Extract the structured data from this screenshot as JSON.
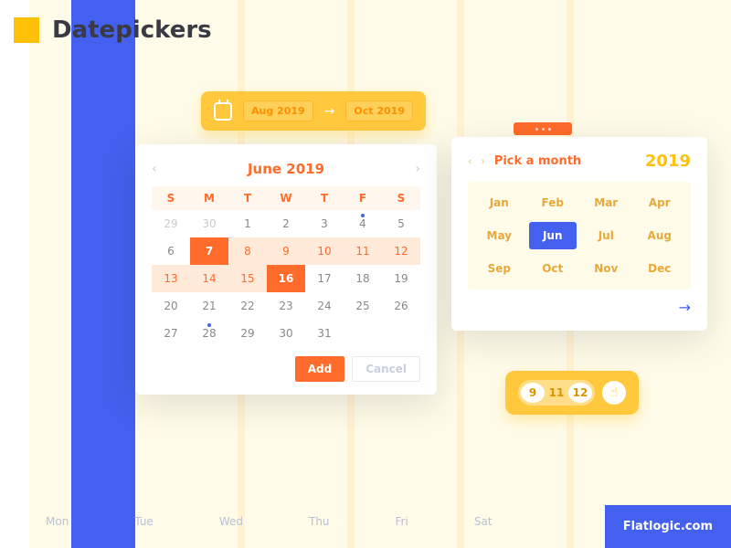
{
  "title": "Datepickers",
  "range": {
    "from": "Aug 2019",
    "to": "Oct 2019"
  },
  "calendar": {
    "title": "June 2019",
    "dow": [
      "S",
      "M",
      "T",
      "W",
      "T",
      "F",
      "S"
    ],
    "weeks": [
      [
        {
          "n": "29",
          "o": 1
        },
        {
          "n": "30",
          "o": 1
        },
        {
          "n": "1"
        },
        {
          "n": "2"
        },
        {
          "n": "3"
        },
        {
          "n": "4",
          "d": 1
        },
        {
          "n": "5"
        }
      ],
      [
        {
          "n": "6"
        },
        {
          "n": "7",
          "s": 1
        },
        {
          "n": "8",
          "r": 1
        },
        {
          "n": "9",
          "r": 1
        },
        {
          "n": "10",
          "r": 1
        },
        {
          "n": "11",
          "r": 1
        },
        {
          "n": "12",
          "r": 1
        }
      ],
      [
        {
          "n": "13",
          "r": 1
        },
        {
          "n": "14",
          "r": 1
        },
        {
          "n": "15",
          "r": 1
        },
        {
          "n": "16",
          "s": 1
        },
        {
          "n": "17"
        },
        {
          "n": "18"
        },
        {
          "n": "19"
        }
      ],
      [
        {
          "n": "20"
        },
        {
          "n": "21"
        },
        {
          "n": "22"
        },
        {
          "n": "23"
        },
        {
          "n": "24"
        },
        {
          "n": "25"
        },
        {
          "n": "26"
        }
      ],
      [
        {
          "n": "27"
        },
        {
          "n": "28",
          "d": 1
        },
        {
          "n": "29"
        },
        {
          "n": "30"
        },
        {
          "n": "31"
        },
        {
          "n": ""
        },
        {
          "n": ""
        }
      ]
    ],
    "add": "Add",
    "cancel": "Cancel"
  },
  "monthPicker": {
    "label": "Pick a month",
    "year": "2019",
    "months": [
      "Jan",
      "Feb",
      "Mar",
      "Apr",
      "May",
      "Jun",
      "Jul",
      "Aug",
      "Sep",
      "Oct",
      "Nov",
      "Dec"
    ],
    "selected": "Jun"
  },
  "slider": {
    "values": [
      "9",
      "11",
      "12"
    ],
    "on": [
      0,
      2
    ]
  },
  "footerDays": [
    "Mon",
    "Tue",
    "Wed",
    "Thu",
    "Fri",
    "Sat"
  ],
  "brand": "Flatlogic.com"
}
